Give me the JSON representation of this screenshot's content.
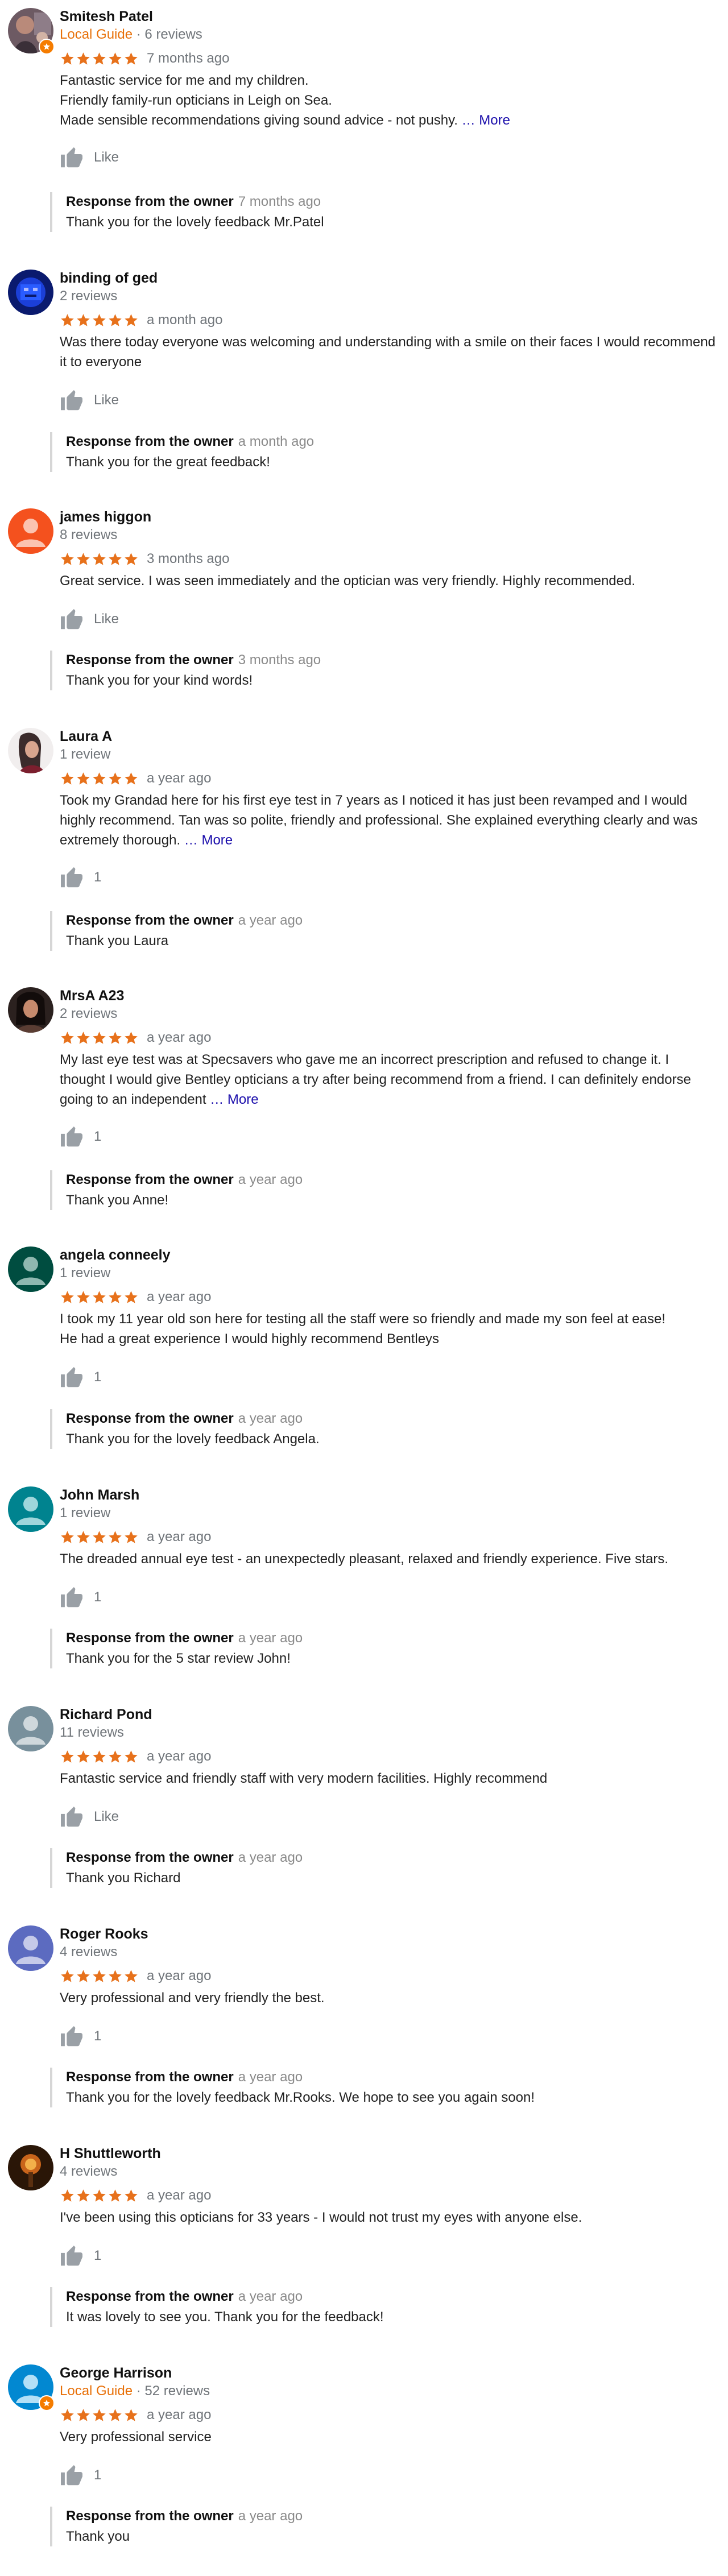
{
  "colors": {
    "star": "#e7711b",
    "local_guide": "#e8710a",
    "more_link": "#1a0dab",
    "muted": "#70757a"
  },
  "owner_label": "Response from the owner",
  "reviews": [
    {
      "name": "Smitesh Patel",
      "local_guide_label": "Local Guide",
      "reviews_count": "6 reviews",
      "rating": 5,
      "time": "7 months ago",
      "text": "Fantastic service for me and my children.\nFriendly family-run opticians in Leigh on Sea.\nMade sensible recommendations giving sound advice - not pushy.",
      "more": "… More",
      "likes": "Like",
      "owner_time": "7 months ago",
      "owner_reply": "Thank you for the lovely feedback Mr.Patel",
      "avatar_icon": "user-photo-icon"
    },
    {
      "name": "binding of ged",
      "reviews_count": "2 reviews",
      "rating": 5,
      "time": "a month ago",
      "text": "Was there today everyone was welcoming and understanding with a smile on their faces I would recommend it to everyone",
      "likes": "Like",
      "owner_time": "a month ago",
      "owner_reply": "Thank you for the great feedback!",
      "avatar_icon": "user-photo-icon"
    },
    {
      "name": "james higgon",
      "reviews_count": "8 reviews",
      "rating": 5,
      "time": "3 months ago",
      "text": "Great service. I was seen immediately and the optician was very friendly. Highly recommended.",
      "likes": "Like",
      "owner_time": "3 months ago",
      "owner_reply": "Thank you for your kind words!",
      "avatar_icon": "default-user-icon"
    },
    {
      "name": "Laura A",
      "reviews_count": "1 review",
      "rating": 5,
      "time": "a year ago",
      "text": "Took my Grandad here for his first eye test in 7 years as I noticed it has just been revamped and I would highly recommend. Tan was so polite, friendly and professional. She explained everything clearly and was extremely thorough.",
      "more": "… More",
      "likes": "1",
      "owner_time": "a year ago",
      "owner_reply": "Thank you Laura",
      "avatar_icon": "user-photo-icon"
    },
    {
      "name": "MrsA A23",
      "reviews_count": "2 reviews",
      "rating": 5,
      "time": "a year ago",
      "text": "My last eye test was at Specsavers who gave me an incorrect prescription and refused to change it. I thought I would give Bentley opticians a try after being recommend from a friend. I can definitely endorse going to an independent",
      "more": "… More",
      "likes": "1",
      "owner_time": "a year ago",
      "owner_reply": "Thank you Anne!",
      "avatar_icon": "user-photo-icon"
    },
    {
      "name": "angela conneely",
      "reviews_count": "1 review",
      "rating": 5,
      "time": "a year ago",
      "text": "I took my 11 year old son here for testing all the staff were so friendly and made my son feel at ease!\nHe had a great experience I would highly recommend Bentleys",
      "likes": "1",
      "owner_time": "a year ago",
      "owner_reply": "Thank you for the lovely feedback Angela.",
      "avatar_icon": "default-user-icon"
    },
    {
      "name": "John Marsh",
      "reviews_count": "1 review",
      "rating": 5,
      "time": "a year ago",
      "text": "The dreaded annual eye test - an unexpectedly pleasant, relaxed and friendly experience. Five stars.",
      "likes": "1",
      "owner_time": "a year ago",
      "owner_reply": "Thank you for the 5 star review John!",
      "avatar_icon": "default-user-icon"
    },
    {
      "name": "Richard Pond",
      "reviews_count": "11 reviews",
      "rating": 5,
      "time": "a year ago",
      "text": "Fantastic service and friendly staff with very modern facilities. Highly recommend",
      "likes": "Like",
      "owner_time": "a year ago",
      "owner_reply": "Thank you Richard",
      "avatar_icon": "default-user-icon"
    },
    {
      "name": "Roger Rooks",
      "reviews_count": "4 reviews",
      "rating": 5,
      "time": "a year ago",
      "text": "Very professional and very friendly the best.",
      "likes": "1",
      "owner_time": "a year ago",
      "owner_reply": "Thank you for the lovely feedback Mr.Rooks. We hope to see you again soon!",
      "avatar_icon": "default-user-icon"
    },
    {
      "name": "H Shuttleworth",
      "reviews_count": "4 reviews",
      "rating": 5,
      "time": "a year ago",
      "text": "I've been using this opticians for 33 years - I would not trust my eyes with anyone else.",
      "likes": "1",
      "owner_time": "a year ago",
      "owner_reply": "It was lovely to see you. Thank you for the feedback!",
      "avatar_icon": "user-photo-icon"
    },
    {
      "name": "George Harrison",
      "local_guide_label": "Local Guide",
      "reviews_count": "52 reviews",
      "rating": 5,
      "time": "a year ago",
      "text": "Very professional service",
      "likes": "1",
      "owner_time": "a year ago",
      "owner_reply": "Thank you",
      "avatar_icon": "default-user-icon"
    }
  ]
}
